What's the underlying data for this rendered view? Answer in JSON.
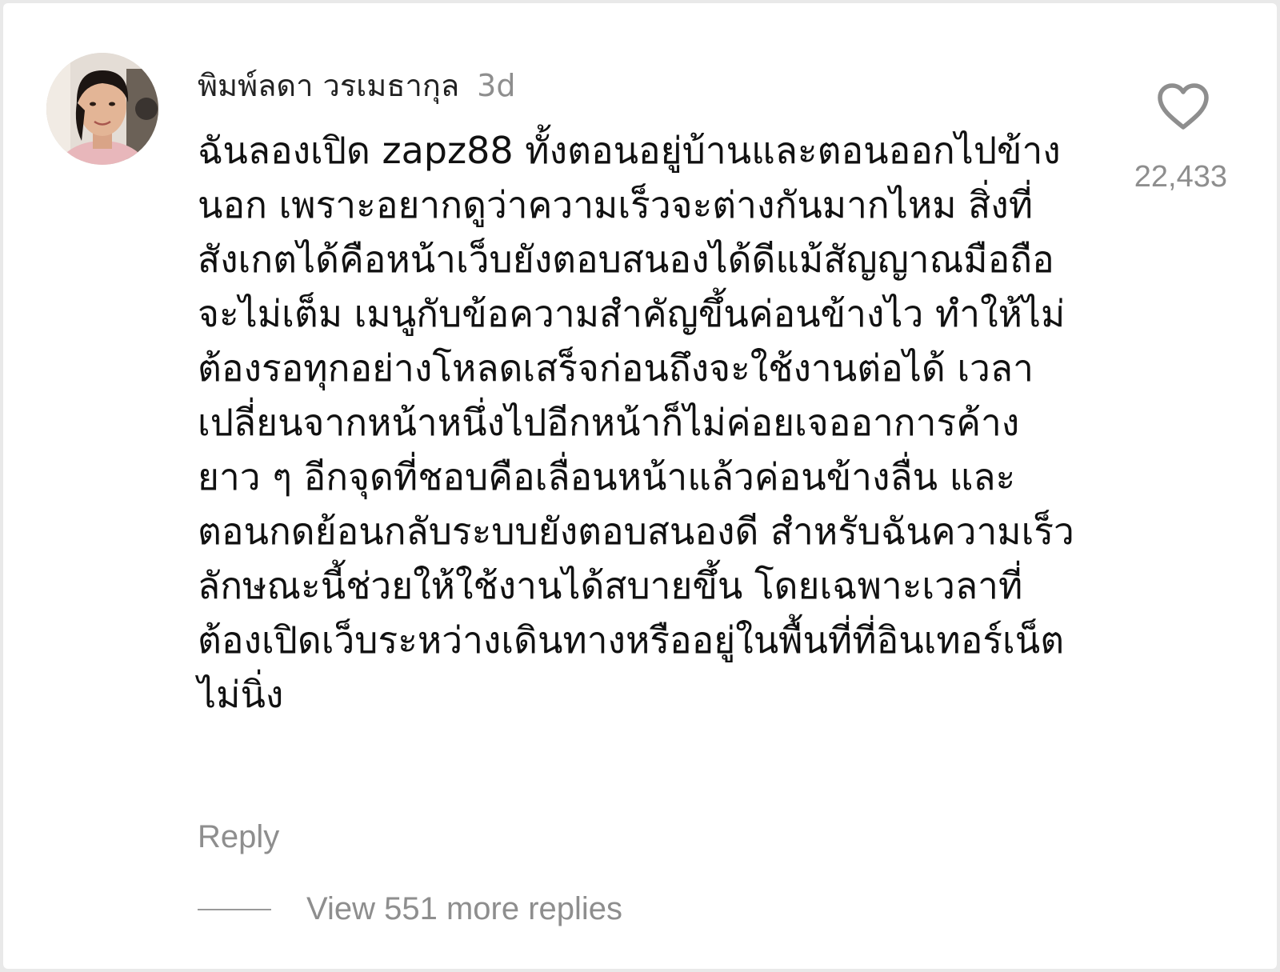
{
  "comment": {
    "username": "พิมพ์ลดา วรเมธากุล",
    "time_ago": "3d",
    "text": "ฉันลองเปิด zapz88 ทั้งตอนอยู่บ้านและตอนออกไปข้างนอก เพราะอยากดูว่าความเร็วจะต่างกันมากไหม สิ่งที่สังเกตได้คือหน้าเว็บยังตอบสนองได้ดีแม้สัญญาณมือถือจะไม่เต็ม เมนูกับข้อความสำคัญขึ้นค่อนข้างไว ทำให้ไม่ต้องรอทุกอย่างโหลดเสร็จก่อนถึงจะใช้งานต่อได้ เวลาเปลี่ยนจากหน้าหนึ่งไปอีกหน้าก็ไม่ค่อยเจออาการค้างยาว ๆ อีกจุดที่ชอบคือเลื่อนหน้าแล้วค่อนข้างลื่น และตอนกดย้อนกลับระบบยังตอบสนองดี สำหรับฉันความเร็วลักษณะนี้ช่วยให้ใช้งานได้สบายขึ้น โดยเฉพาะเวลาที่ต้องเปิดเว็บระหว่างเดินทางหรืออยู่ในพื้นที่ที่อินเทอร์เน็ตไม่นิ่ง",
    "reply_label": "Reply",
    "like_count": "22,433",
    "like_icon": "heart-outline-icon",
    "view_replies_label": "View 551 more replies"
  },
  "colors": {
    "text_primary": "#111111",
    "text_secondary": "#8e8e8e",
    "background": "#ffffff"
  }
}
